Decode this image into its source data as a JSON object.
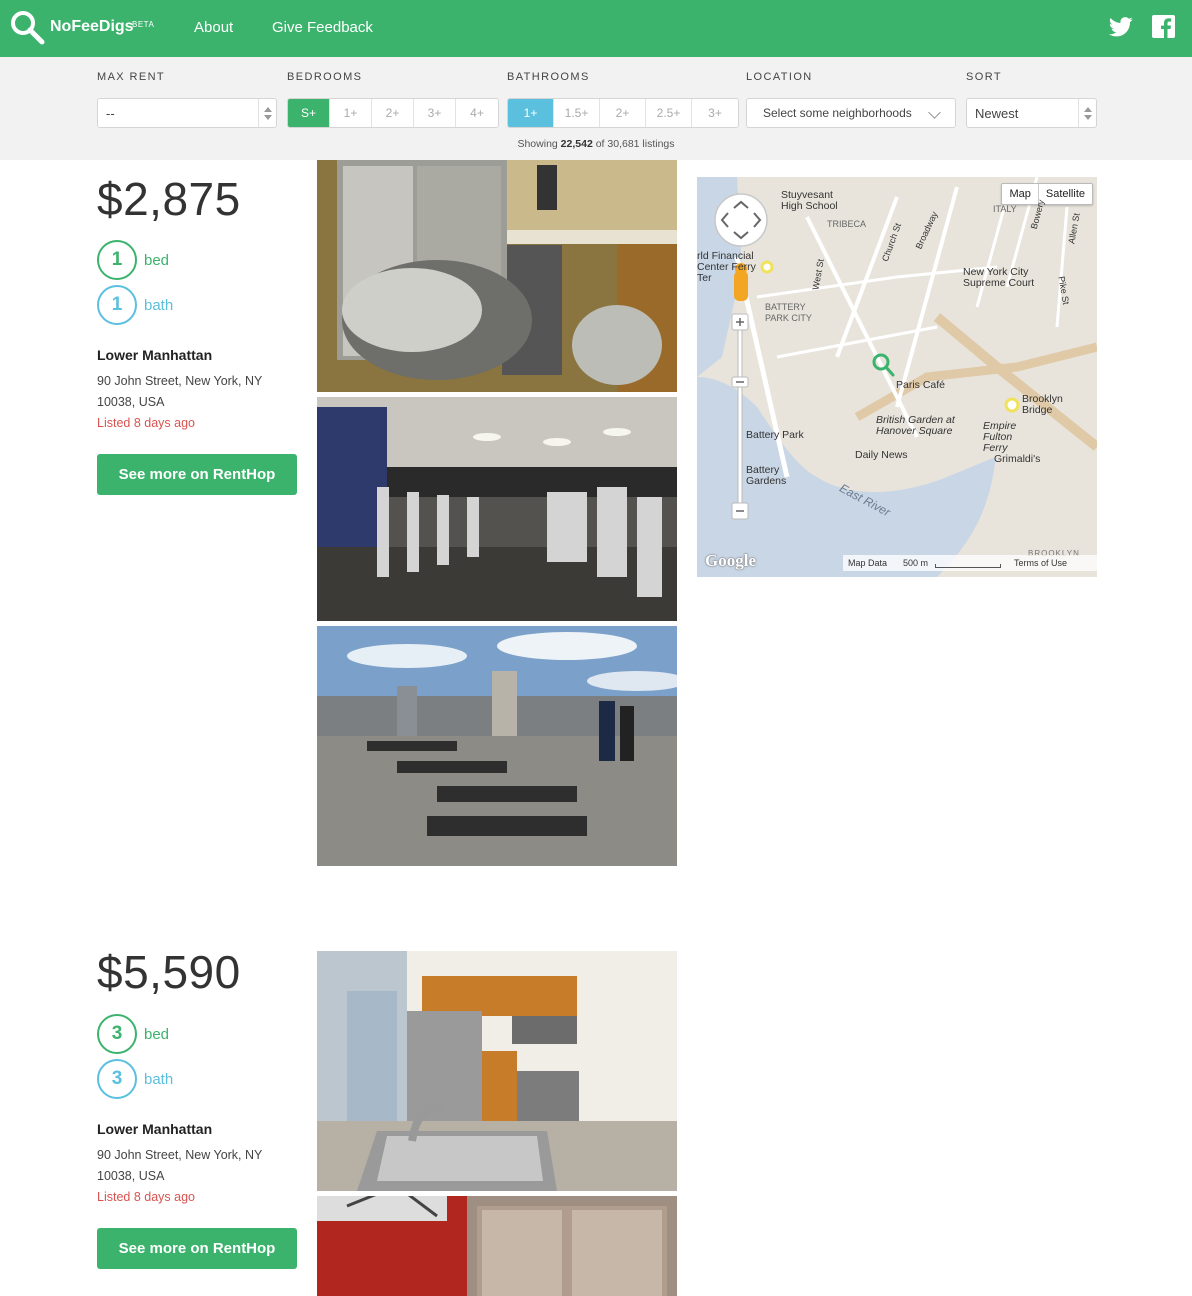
{
  "nav": {
    "brand": "NoFeeDigs",
    "beta": "BETA",
    "about": "About",
    "feedback": "Give Feedback",
    "brand_color": "#3bb36c"
  },
  "filters": {
    "max_rent_label": "MAX RENT",
    "max_rent_value": "--",
    "bedrooms_label": "BEDROOMS",
    "bedroom_options": [
      "S+",
      "1+",
      "2+",
      "3+",
      "4+"
    ],
    "bedroom_selected": "S+",
    "bathrooms_label": "BATHROOMS",
    "bathroom_options": [
      "1+",
      "1.5+",
      "2+",
      "2.5+",
      "3+"
    ],
    "bathroom_selected": "1+",
    "location_label": "LOCATION",
    "location_placeholder": "Select some neighborhoods",
    "sort_label": "SORT",
    "sort_value": "Newest",
    "showing_prefix": "Showing",
    "showing_count": "22,542",
    "showing_suffix": "of 30,681 listings"
  },
  "listings": [
    {
      "price": "$2,875",
      "beds": "1",
      "bed_label": "bed",
      "baths": "1",
      "bath_label": "bath",
      "neighborhood": "Lower Manhattan",
      "address": "90 John Street, New York, NY 10038, USA",
      "listed": "Listed 8 days ago",
      "button": "See more on RentHop"
    },
    {
      "price": "$5,590",
      "beds": "3",
      "bed_label": "bed",
      "baths": "3",
      "bath_label": "bath",
      "neighborhood": "Lower Manhattan",
      "address": "90 John Street, New York, NY 10038, USA",
      "listed": "Listed 8 days ago",
      "button": "See more on RentHop"
    }
  ],
  "map": {
    "type_map": "Map",
    "type_satellite": "Satellite",
    "labels": {
      "stuyvesant": "Stuyvesant High School",
      "tribeca": "TRIBECA",
      "wfc": "rld Financial Center Ferry Ter",
      "battery_park_city": "BATTERY PARK CITY",
      "ny_supreme": "New York City Supreme Court",
      "paris_cafe": "Paris Café",
      "brooklyn_bridge": "Brooklyn Bridge",
      "british_garden": "British Garden at Hanover Square",
      "battery_park": "Battery Park",
      "empire": "Empire Fulton Ferry",
      "grimaldis": "Grimaldi's",
      "daily_news": "Daily News",
      "battery_gardens": "Battery Gardens",
      "east_river": "East River",
      "little_italy": "ITALY",
      "church_st": "Church St",
      "broadway": "Broadway",
      "west_st": "West St",
      "pike_st": "Pike St",
      "allen_st": "Allen St",
      "bowery": "Bowery",
      "brooklyn": "BROOKLYN"
    },
    "google": "Google",
    "map_data": "Map Data",
    "scale": "500 m",
    "terms": "Terms of Use"
  }
}
